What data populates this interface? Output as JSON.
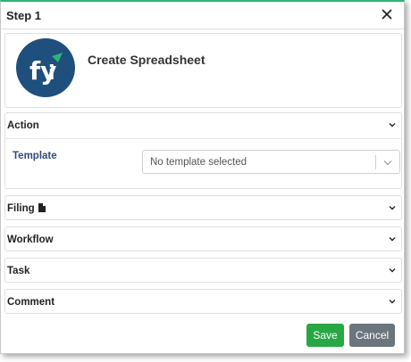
{
  "dialog": {
    "title": "Step 1",
    "accent_color": "#2bb673",
    "close_icon": "close-icon"
  },
  "hero": {
    "title": "Create Spreadsheet",
    "logo_color": "#1f4f7c",
    "logo_accent_color": "#2bb673"
  },
  "sections": {
    "action": {
      "label": "Action",
      "expanded": true
    },
    "filing": {
      "label": "Filing",
      "icon": "document-icon",
      "expanded": false
    },
    "workflow": {
      "label": "Workflow",
      "expanded": false
    },
    "task": {
      "label": "Task",
      "expanded": false
    },
    "comment": {
      "label": "Comment",
      "expanded": false
    }
  },
  "template": {
    "label": "Template",
    "placeholder": "No template selected"
  },
  "footer": {
    "save_label": "Save",
    "save_color": "#28a745",
    "cancel_label": "Cancel",
    "cancel_color": "#6c757d"
  }
}
